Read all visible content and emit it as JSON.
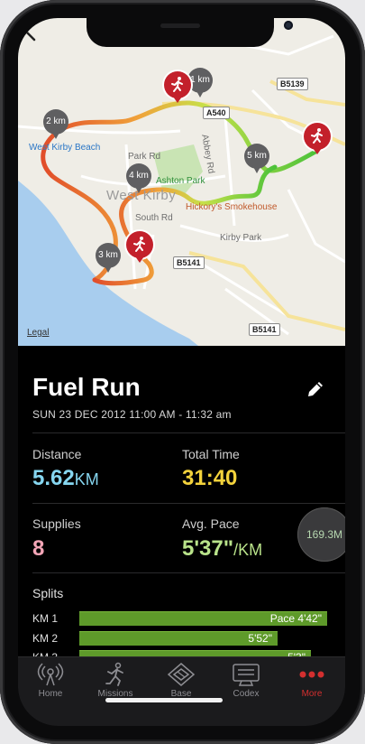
{
  "map": {
    "labels": {
      "area": "West Kirby",
      "beach": "West Kirby Beach",
      "park_rd": "Park Rd",
      "south_rd": "South Rd",
      "kirby_park": "Kirby Park",
      "abbey_rd": "Abbey Rd",
      "ashton_park": "Ashton Park",
      "hickorys": "Hickory's Smokehouse",
      "legal": "Legal"
    },
    "road_badges": [
      "B5139",
      "A540",
      "B5141",
      "B5141"
    ],
    "km_markers": [
      "2 km",
      "1 km",
      "5 km",
      "4 km",
      "3 km"
    ]
  },
  "run": {
    "title": "Fuel Run",
    "date": "SUN 23 DEC 2012 11:00 AM - 11:32 am",
    "distance_label": "Distance",
    "distance_value": "5.62",
    "distance_unit": "KM",
    "time_label": "Total Time",
    "time_value": "31:40",
    "supplies_label": "Supplies",
    "supplies_value": "8",
    "pace_label": "Avg. Pace",
    "pace_value": "5'37\"",
    "pace_unit": "/KM",
    "supplies_circle": "169.3M"
  },
  "splits": {
    "title": "Splits",
    "rows": [
      {
        "label": "KM 1",
        "text": "Pace 4'42\"",
        "fraction": 1.0
      },
      {
        "label": "KM 2",
        "text": "5'52\"",
        "fraction": 0.8
      },
      {
        "label": "KM 3",
        "text": "5'3\"",
        "fraction": 0.9
      }
    ]
  },
  "tabs": [
    {
      "label": "Home",
      "icon": "radio-tower-icon",
      "active": false
    },
    {
      "label": "Missions",
      "icon": "runner-icon",
      "active": false
    },
    {
      "label": "Base",
      "icon": "base-icon",
      "active": false
    },
    {
      "label": "Codex",
      "icon": "codex-icon",
      "active": false
    },
    {
      "label": "More",
      "icon": "more-dots-icon",
      "active": true
    }
  ],
  "colors": {
    "distance": "#86d6f0",
    "time": "#f3d23c",
    "supplies": "#f3a5b6",
    "pace": "#b9e38a",
    "active_tab": "#d32f2f",
    "split_bar": "#5e9a2a"
  }
}
